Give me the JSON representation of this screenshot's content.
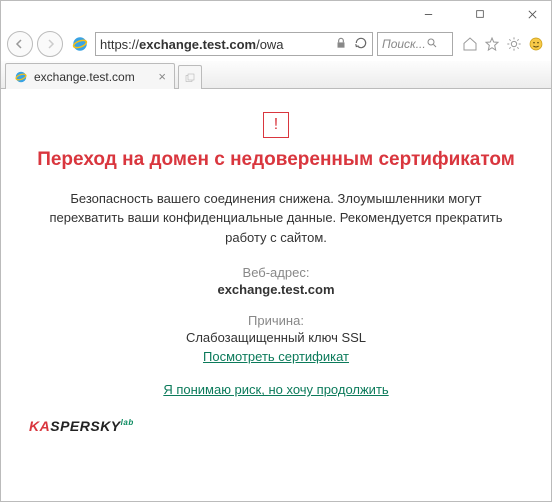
{
  "window": {
    "minimize": "–",
    "maximize": "☐",
    "close": "✕"
  },
  "address": {
    "scheme": "https://",
    "host": "exchange.test.com",
    "path": "/owa"
  },
  "search": {
    "placeholder": "Поиск..."
  },
  "tab": {
    "title": "exchange.test.com"
  },
  "warning": {
    "title": "Переход на домен с недоверенным сертификатом",
    "body": "Безопасность вашего соединения снижена. Злоумышленники могут перехватить ваши конфиденциальные данные. Рекомендуется прекратить работу с сайтом.",
    "web_address_label": "Веб-адрес:",
    "web_address_value": "exchange.test.com",
    "reason_label": "Причина:",
    "reason_value": "Слабозащищенный ключ SSL",
    "view_cert": "Посмотреть сертификат",
    "proceed": "Я понимаю риск, но хочу продолжить"
  },
  "brand": {
    "ka": "KA",
    "spersky": "SPERSKY",
    "lab": "lab"
  }
}
